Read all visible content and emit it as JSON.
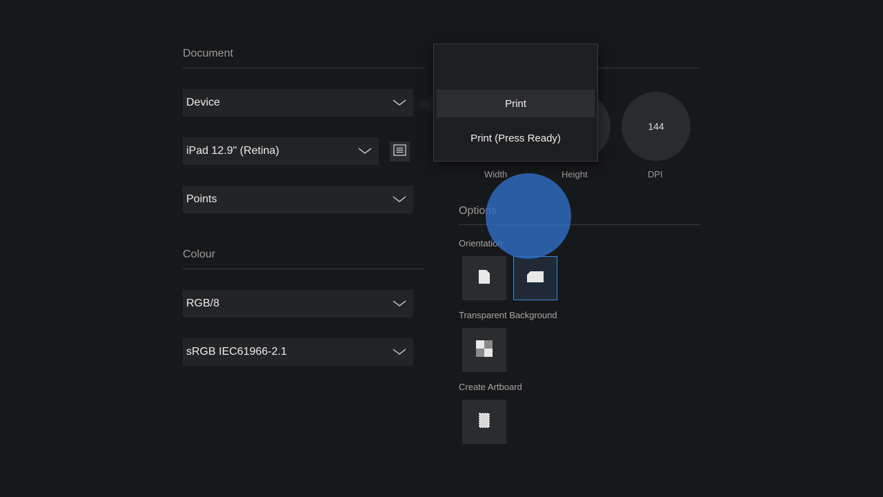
{
  "document": {
    "title": "Document",
    "dropdowns": [
      {
        "id": "type",
        "value": "Device"
      },
      {
        "id": "preset",
        "value": "iPad 12.9\" (Retina)"
      },
      {
        "id": "units",
        "value": "Points"
      }
    ]
  },
  "colour": {
    "title": "Colour",
    "dropdowns": [
      {
        "id": "format",
        "value": "RGB/8"
      },
      {
        "id": "profile",
        "value": "sRGB IEC61966-2.1"
      }
    ]
  },
  "dimensions": {
    "width_label": "Width",
    "height_label": "Height",
    "dpi_label": "DPI",
    "dpi_value": "144"
  },
  "options": {
    "title": "Options",
    "orientation_label": "Orientation",
    "transparent_label": "Transparent Background",
    "artboard_label": "Create Artboard"
  },
  "popover": {
    "items": [
      {
        "label": "",
        "highlighted": false
      },
      {
        "label": "Print",
        "highlighted": true
      },
      {
        "label": "Print (Press Ready)",
        "highlighted": false
      }
    ]
  },
  "colors": {
    "accent": "#3a8fdc",
    "touch": "#2f6cc4",
    "background": "#17181a"
  },
  "icons": {
    "dropdown": "chevron-down-icon",
    "preset_list": "list-icon",
    "portrait": "portrait-page-icon",
    "landscape": "landscape-page-icon",
    "transparent": "checkerboard-icon",
    "artboard": "artboard-icon"
  }
}
